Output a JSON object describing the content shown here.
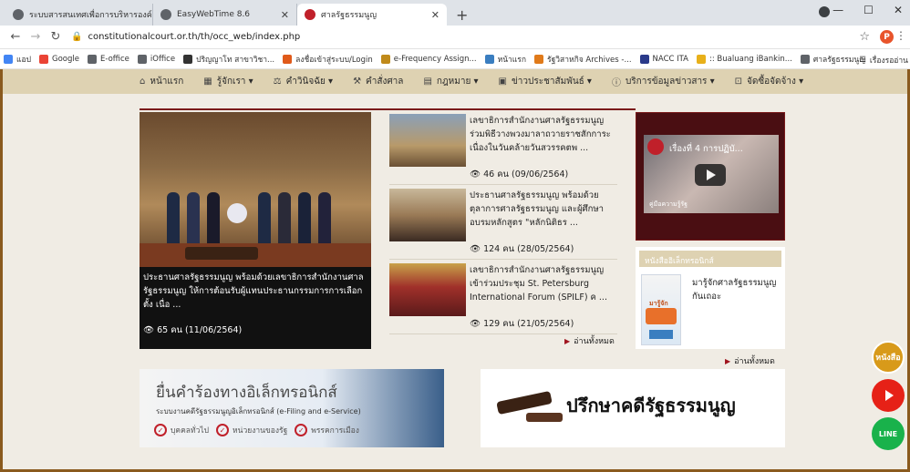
{
  "browser": {
    "tabs": [
      {
        "label": "ระบบสารสนเทศเพื่อการบริหารองค์กร",
        "color": "#5f6368"
      },
      {
        "label": "EasyWebTime 8.6",
        "color": "#5f6368"
      },
      {
        "label": "ศาลรัฐธรรมนูญ",
        "color": "#c0202a"
      }
    ],
    "new_tab": "+",
    "url": "constitutionalcourt.or.th/th/occ_web/index.php",
    "profile_initial": "P",
    "bookmarks": [
      {
        "label": "แอป",
        "color": "#4285f4"
      },
      {
        "label": "Google",
        "color": "#ea4335"
      },
      {
        "label": "E-office",
        "color": "#5f6368"
      },
      {
        "label": "iOffice",
        "color": "#5f6368"
      },
      {
        "label": "ปริญญาโท สาขาวิชา...",
        "color": "#333333"
      },
      {
        "label": "ลงชื่อเข้าสู่ระบบ/Login",
        "color": "#e05a1a"
      },
      {
        "label": "e-Frequency Assign...",
        "color": "#c08a1a"
      },
      {
        "label": "หน้าแรก",
        "color": "#3a7ec0"
      },
      {
        "label": "รัฐวิสาหกิจ Archives -...",
        "color": "#e07a1a"
      },
      {
        "label": "NACC ITA",
        "color": "#2a3a8a"
      },
      {
        "label": ":: Bualuang iBankin...",
        "color": "#e8b01a"
      },
      {
        "label": "ศาลรัฐธรรมนูญ",
        "color": "#5f6368"
      }
    ],
    "bookmarks_right": "เรื่องรออ่าน"
  },
  "site_nav": [
    {
      "label": "หน้าแรก",
      "icon": "home-icon",
      "glyph": "⌂"
    },
    {
      "label": "รู้จักเรา ▾",
      "icon": "building-icon",
      "glyph": "▦"
    },
    {
      "label": "คำวินิจฉัย ▾",
      "icon": "scale-icon",
      "glyph": "⚖"
    },
    {
      "label": "คำสั่งศาล",
      "icon": "gavel-icon",
      "glyph": "⚒"
    },
    {
      "label": "กฎหมาย ▾",
      "icon": "book-icon",
      "glyph": "▤"
    },
    {
      "label": "ข่าวประชาสัมพันธ์ ▾",
      "icon": "news-icon",
      "glyph": "▣"
    },
    {
      "label": "บริการข้อมูลข่าวสาร ▾",
      "icon": "info-icon",
      "glyph": "ⓘ"
    },
    {
      "label": "จัดซื้อจัดจ้าง ▾",
      "icon": "cart-icon",
      "glyph": "⊡"
    }
  ],
  "featured": {
    "caption": "ประธานศาลรัฐธรรมนูญ พร้อมด้วยเลขาธิการสำนักงานศาลรัฐธรรมนูญ ให้การต้อนรับผู้แทนประธานกรรมการการเลือกตั้ง เนื่อ ...",
    "views": "👁 65 คน (11/06/2564)"
  },
  "news": [
    {
      "title": "เลขาธิการสำนักงานศาลรัฐธรรมนูญ ร่วมพิธีวางพวงมาลาถวายราชสักการะ เนื่องในวันคล้ายวันสวรรคตพ ...",
      "views": "👁 46 คน (09/06/2564)"
    },
    {
      "title": "ประธานศาลรัฐธรรมนูญ พร้อมด้วยตุลาการศาลรัฐธรรมนูญ และผู้ศึกษาอบรมหลักสูตร \"หลักนิติธร ...",
      "views": "👁 124 คน (28/05/2564)"
    },
    {
      "title": "เลขาธิการสำนักงานศาลรัฐธรรมนูญ เข้าร่วมประชุม St. Petersburg International Forum (SPILF) ค ...",
      "views": "👁 129 คน (21/05/2564)"
    }
  ],
  "read_all": "อ่านทั้งหมด",
  "video": {
    "title": "เรื่องที่ 4 การปฏิบั...",
    "sub": "คู่มือความรู้รัฐ"
  },
  "ebook": {
    "header": "หนังสืออิเล็กทรอนิกส์",
    "title": "มารู้จักศาลรัฐธรรมนูญกันเถอะ",
    "cover_text": "มารู้จัก ศาล"
  },
  "banner_efiling": {
    "title": "ยื่นคำร้องทางอิเล็กทรอนิกส์",
    "subtitle": "ระบบงานคดีรัฐธรรมนูญอิเล็กทรอนิกส์ (e-Filing and e-Service)",
    "options": [
      "บุคคลทั่วไป",
      "หน่วยงานของรัฐ",
      "พรรคการเมือง"
    ]
  },
  "banner_consult": {
    "title": "ปรึกษาคดีรัฐธรรมนูญ"
  },
  "float_buttons": {
    "ebook": "หนังสือ",
    "line": "LINE"
  }
}
